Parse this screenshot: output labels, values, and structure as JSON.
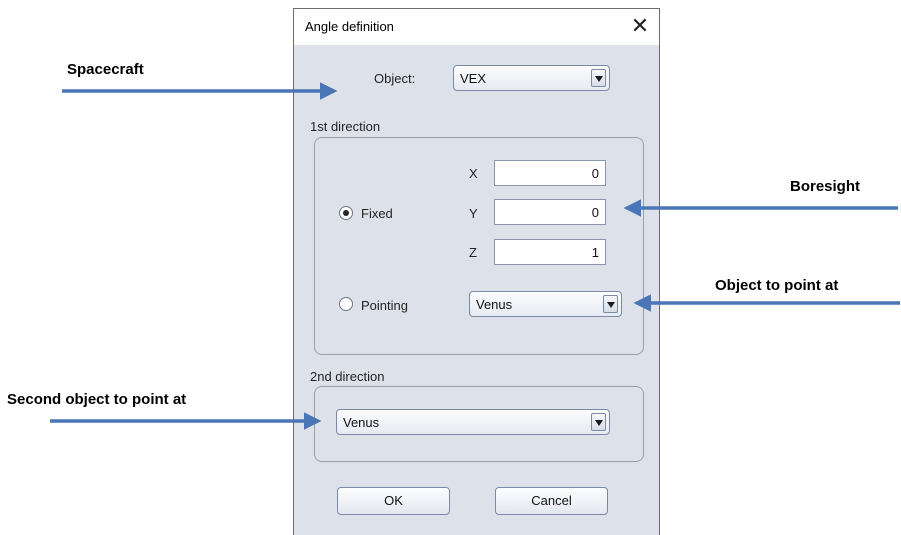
{
  "dialog": {
    "title": "Angle definition",
    "close_glyph": "✕",
    "object_label": "Object:",
    "object_value": "VEX",
    "first_direction": {
      "legend": "1st direction",
      "fixed_label": "Fixed",
      "fixed_selected": true,
      "x_label": "X",
      "x_value": "0",
      "y_label": "Y",
      "y_value": "0",
      "z_label": "Z",
      "z_value": "1",
      "pointing_label": "Pointing",
      "pointing_value": "Venus"
    },
    "second_direction": {
      "legend": "2nd direction",
      "value": "Venus"
    },
    "ok_label": "OK",
    "cancel_label": "Cancel"
  },
  "annotations": {
    "spacecraft": "Spacecraft",
    "boresight": "Boresight",
    "object_to_point": "Object to point at",
    "second_object": "Second object to point at"
  },
  "colors": {
    "arrow": "#4a76b6",
    "dialog_bg": "#dde1e9"
  }
}
